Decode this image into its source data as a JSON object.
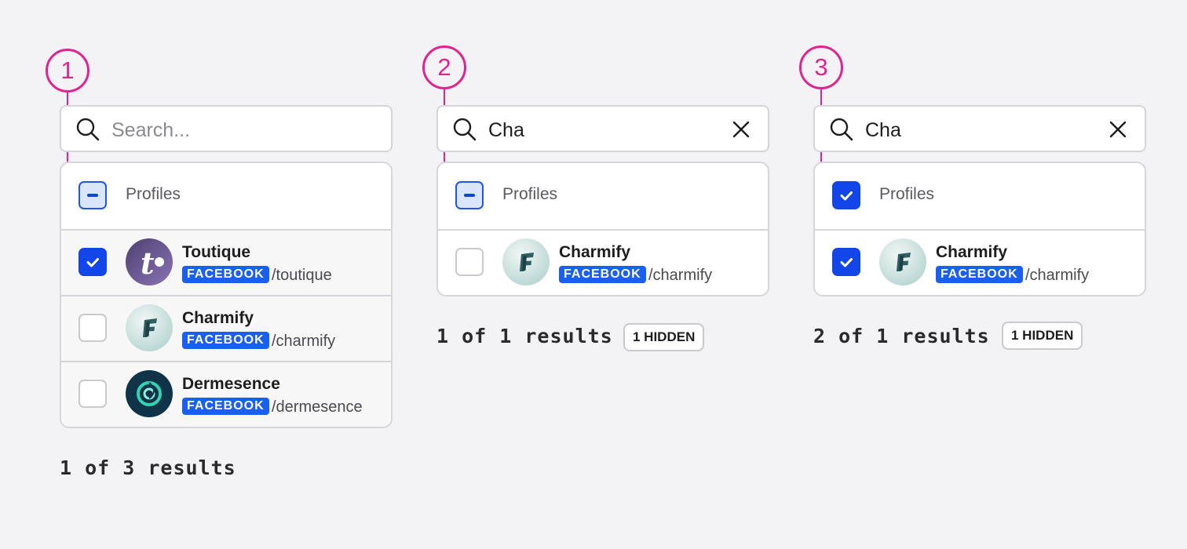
{
  "colors": {
    "background": "#f3f3f5",
    "accent_pink": "#e0248f",
    "checkbox_blue": "#1246e8",
    "badge_blue": "#1a5fef"
  },
  "panels": [
    {
      "step": "1",
      "search": {
        "value": "",
        "placeholder": "Search...",
        "clear_icon": false
      },
      "header": {
        "label": "Profiles",
        "checkbox_state": "indeterminate"
      },
      "profiles": [
        {
          "name": "Toutique",
          "platform": "FACEBOOK",
          "handle": "/toutique",
          "checked": true,
          "avatar_icon": "toutique-logo"
        },
        {
          "name": "Charmify",
          "platform": "FACEBOOK",
          "handle": "/charmify",
          "checked": false,
          "avatar_icon": "charmify-logo"
        },
        {
          "name": "Dermesence",
          "platform": "FACEBOOK",
          "handle": "/dermesence",
          "checked": false,
          "avatar_icon": "dermesence-logo"
        }
      ],
      "results": "1 of 3 results",
      "hidden_badge": ""
    },
    {
      "step": "2",
      "search": {
        "value": "Cha",
        "placeholder": "Search...",
        "clear_icon": true
      },
      "header": {
        "label": "Profiles",
        "checkbox_state": "indeterminate"
      },
      "profiles": [
        {
          "name": "Charmify",
          "platform": "FACEBOOK",
          "handle": "/charmify",
          "checked": false,
          "avatar_icon": "charmify-logo"
        }
      ],
      "results": "1 of 1 results",
      "hidden_badge": "1 HIDDEN"
    },
    {
      "step": "3",
      "search": {
        "value": "Cha",
        "placeholder": "Search...",
        "clear_icon": true
      },
      "header": {
        "label": "Profiles",
        "checkbox_state": "checked"
      },
      "profiles": [
        {
          "name": "Charmify",
          "platform": "FACEBOOK",
          "handle": "/charmify",
          "checked": true,
          "avatar_icon": "charmify-logo"
        }
      ],
      "results": "2 of 1 results",
      "hidden_badge": "1 HIDDEN"
    }
  ]
}
